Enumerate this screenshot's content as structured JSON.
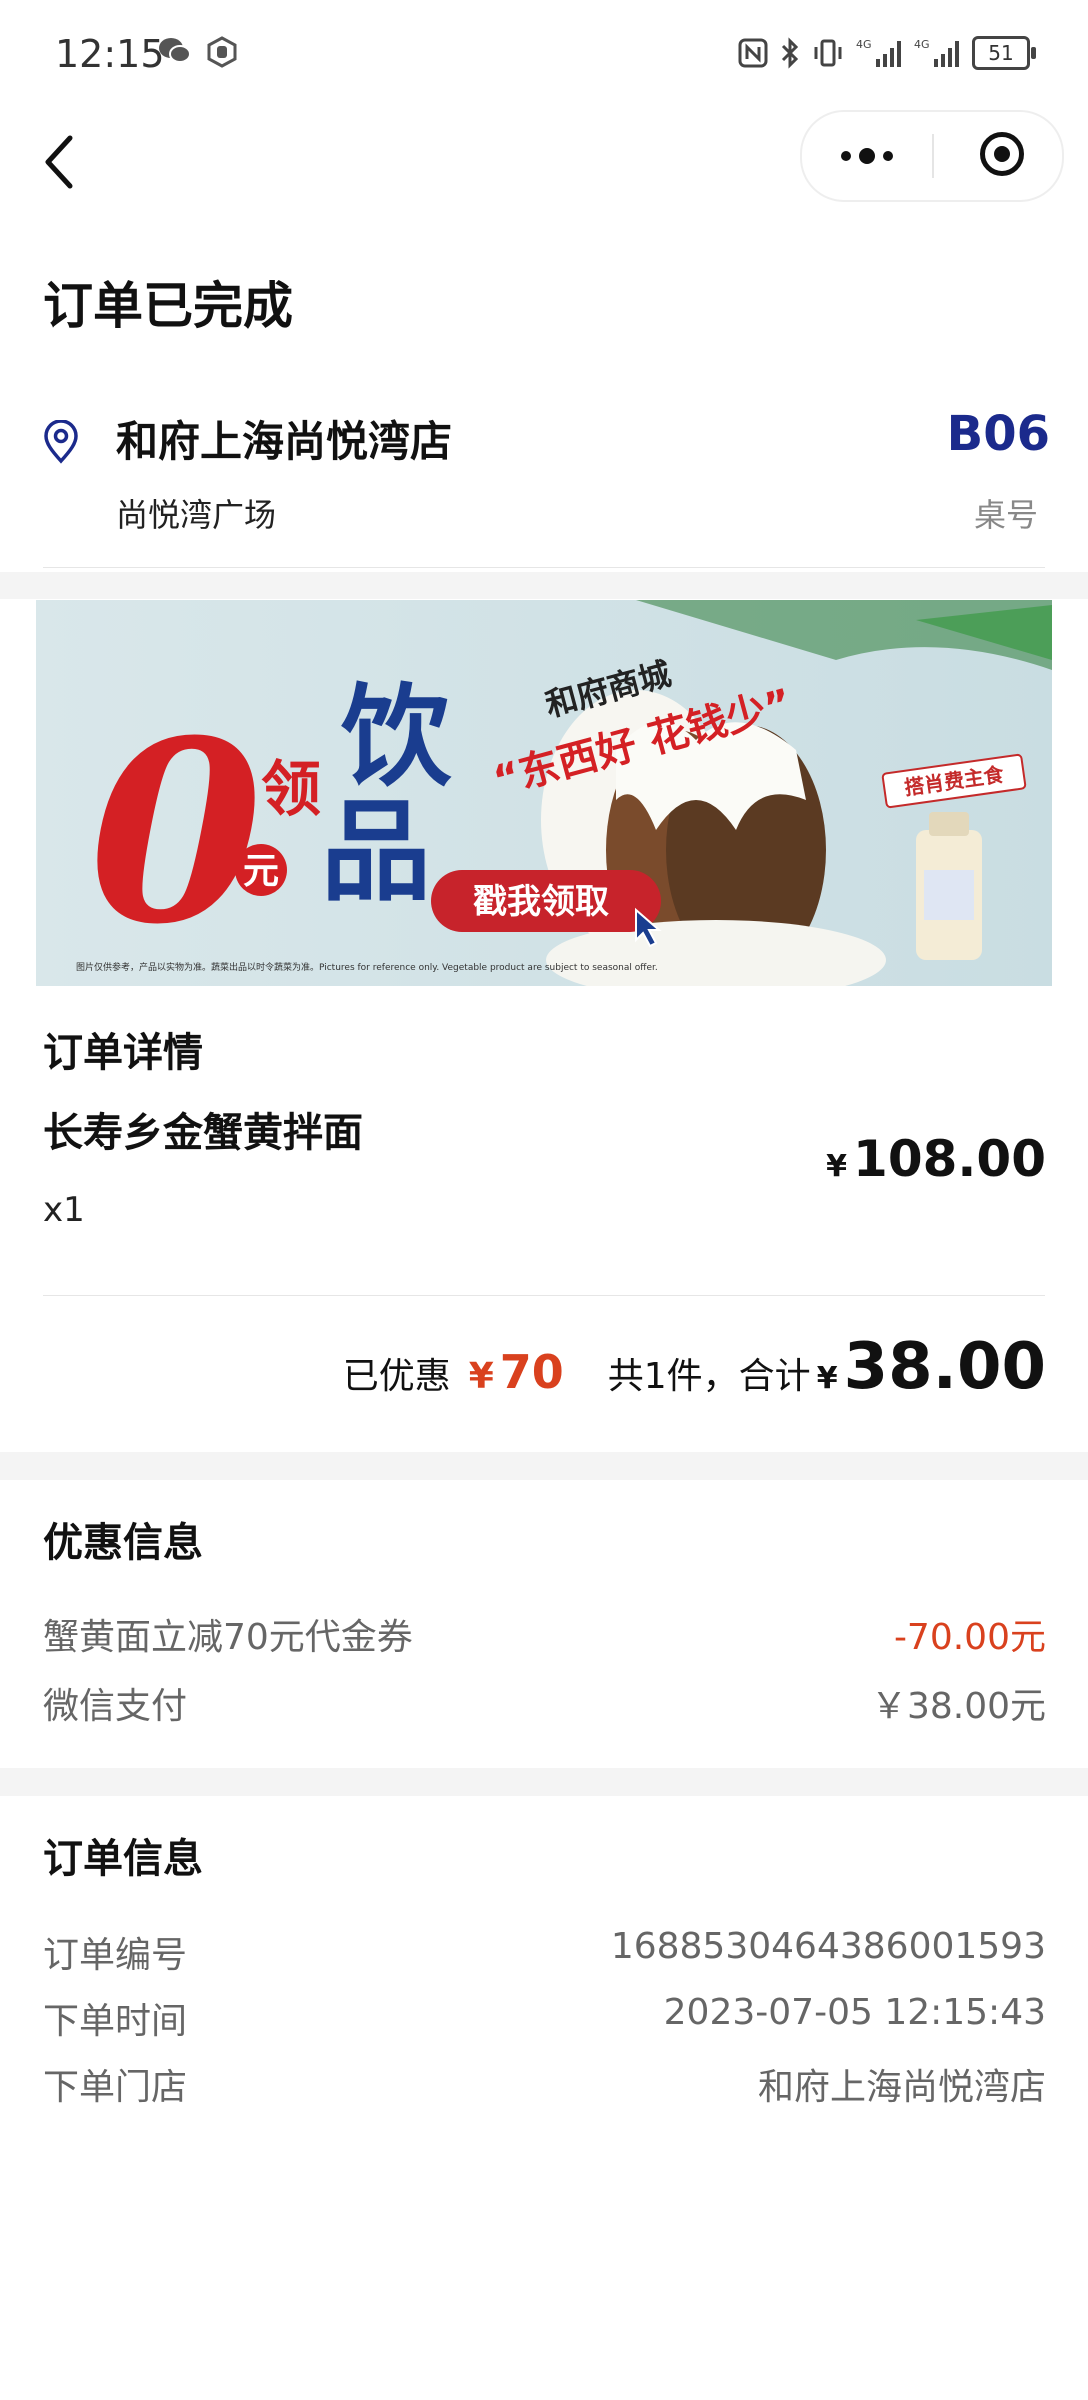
{
  "status_bar": {
    "time": "12:15",
    "left_icons": [
      "wechat-icon",
      "hand-icon"
    ],
    "right_icons": [
      "nfc-icon",
      "bluetooth-icon",
      "vibrate-icon",
      "signal-4g-icon",
      "signal-4g-icon"
    ],
    "battery": "51"
  },
  "nav": {
    "back_icon": "chevron-left-icon",
    "more_icon": "more-dots-icon",
    "close_icon": "target-icon"
  },
  "page_title": "订单已完成",
  "store": {
    "name": "和府上海尚悦湾店",
    "subtitle": "尚悦湾广场",
    "table_no": "B06",
    "table_label": "桌号"
  },
  "banner": {
    "zero": "0",
    "yuan": "元",
    "ling": "领",
    "yin": "饮",
    "pin": "品",
    "mall": "和府商城",
    "slogan": "“东西好 花钱少”",
    "cta": "戳我领取",
    "badge": "搭肖费主食",
    "disclaimer": "图片仅供参考，产品以实物为准。蔬菜出品以时令蔬菜为准。Pictures for reference only. Vegetable product are subject to seasonal offer."
  },
  "order_detail": {
    "title": "订单详情",
    "item_name": "长寿乡金蟹黄拌面",
    "item_qty": "x1",
    "currency": "¥",
    "item_price": "108.00",
    "discount_label": "已优惠",
    "discount_value": "70",
    "count_label": "共1件，合计",
    "total": "38.00"
  },
  "promo_info": {
    "title": "优惠信息",
    "rows": [
      {
        "label": "蟹黄面立减70元代金券",
        "value": "-70.00元"
      },
      {
        "label": "微信支付",
        "value": "￥38.00元"
      }
    ]
  },
  "order_info": {
    "title": "订单信息",
    "rows": [
      {
        "label": "订单编号",
        "value": "1688530464386001593"
      },
      {
        "label": "下单时间",
        "value": "2023-07-05 12:15:43"
      },
      {
        "label": "下单门店",
        "value": "和府上海尚悦湾店"
      }
    ]
  },
  "colors": {
    "accent_red": "#d9411e",
    "table_blue": "#1b2a8c",
    "banner_red": "#d42024",
    "banner_blue": "#1a3d8f"
  }
}
